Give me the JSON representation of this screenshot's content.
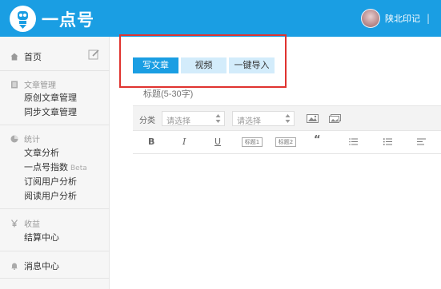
{
  "header": {
    "app_title": "一点号",
    "username": "陕北印记",
    "separator": "|",
    "brand_color": "#1a9ee3"
  },
  "sidebar": {
    "home": {
      "label": "首页",
      "icon": "home-icon"
    },
    "edit_icon": "edit-icon",
    "groups": [
      {
        "title": "文章管理",
        "icon": "document-icon",
        "items": [
          {
            "label": "原创文章管理"
          },
          {
            "label": "同步文章管理"
          }
        ]
      },
      {
        "title": "统计",
        "icon": "pie-chart-icon",
        "items": [
          {
            "label": "文章分析"
          },
          {
            "label": "一点号指数",
            "badge": "Beta"
          },
          {
            "label": "订阅用户分析"
          },
          {
            "label": "阅读用户分析"
          }
        ]
      },
      {
        "title": "收益",
        "icon": "yen-icon",
        "items": [
          {
            "label": "结算中心"
          }
        ]
      }
    ],
    "messages": {
      "label": "消息中心",
      "icon": "bell-icon"
    }
  },
  "main": {
    "tabs": [
      {
        "label": "写文章",
        "active": true
      },
      {
        "label": "视频",
        "active": false
      },
      {
        "label": "一键导入",
        "active": false
      }
    ],
    "title_placeholder": "标题(5-30字)",
    "category": {
      "label": "分类",
      "select_1_placeholder": "请选择",
      "select_2_placeholder": "请选择"
    },
    "toolbar": {
      "bold": "B",
      "italic": "I",
      "underline": "U",
      "heading1": "标题1",
      "heading2": "标题2",
      "quote": "“"
    },
    "highlight_color": "#e0332f"
  }
}
